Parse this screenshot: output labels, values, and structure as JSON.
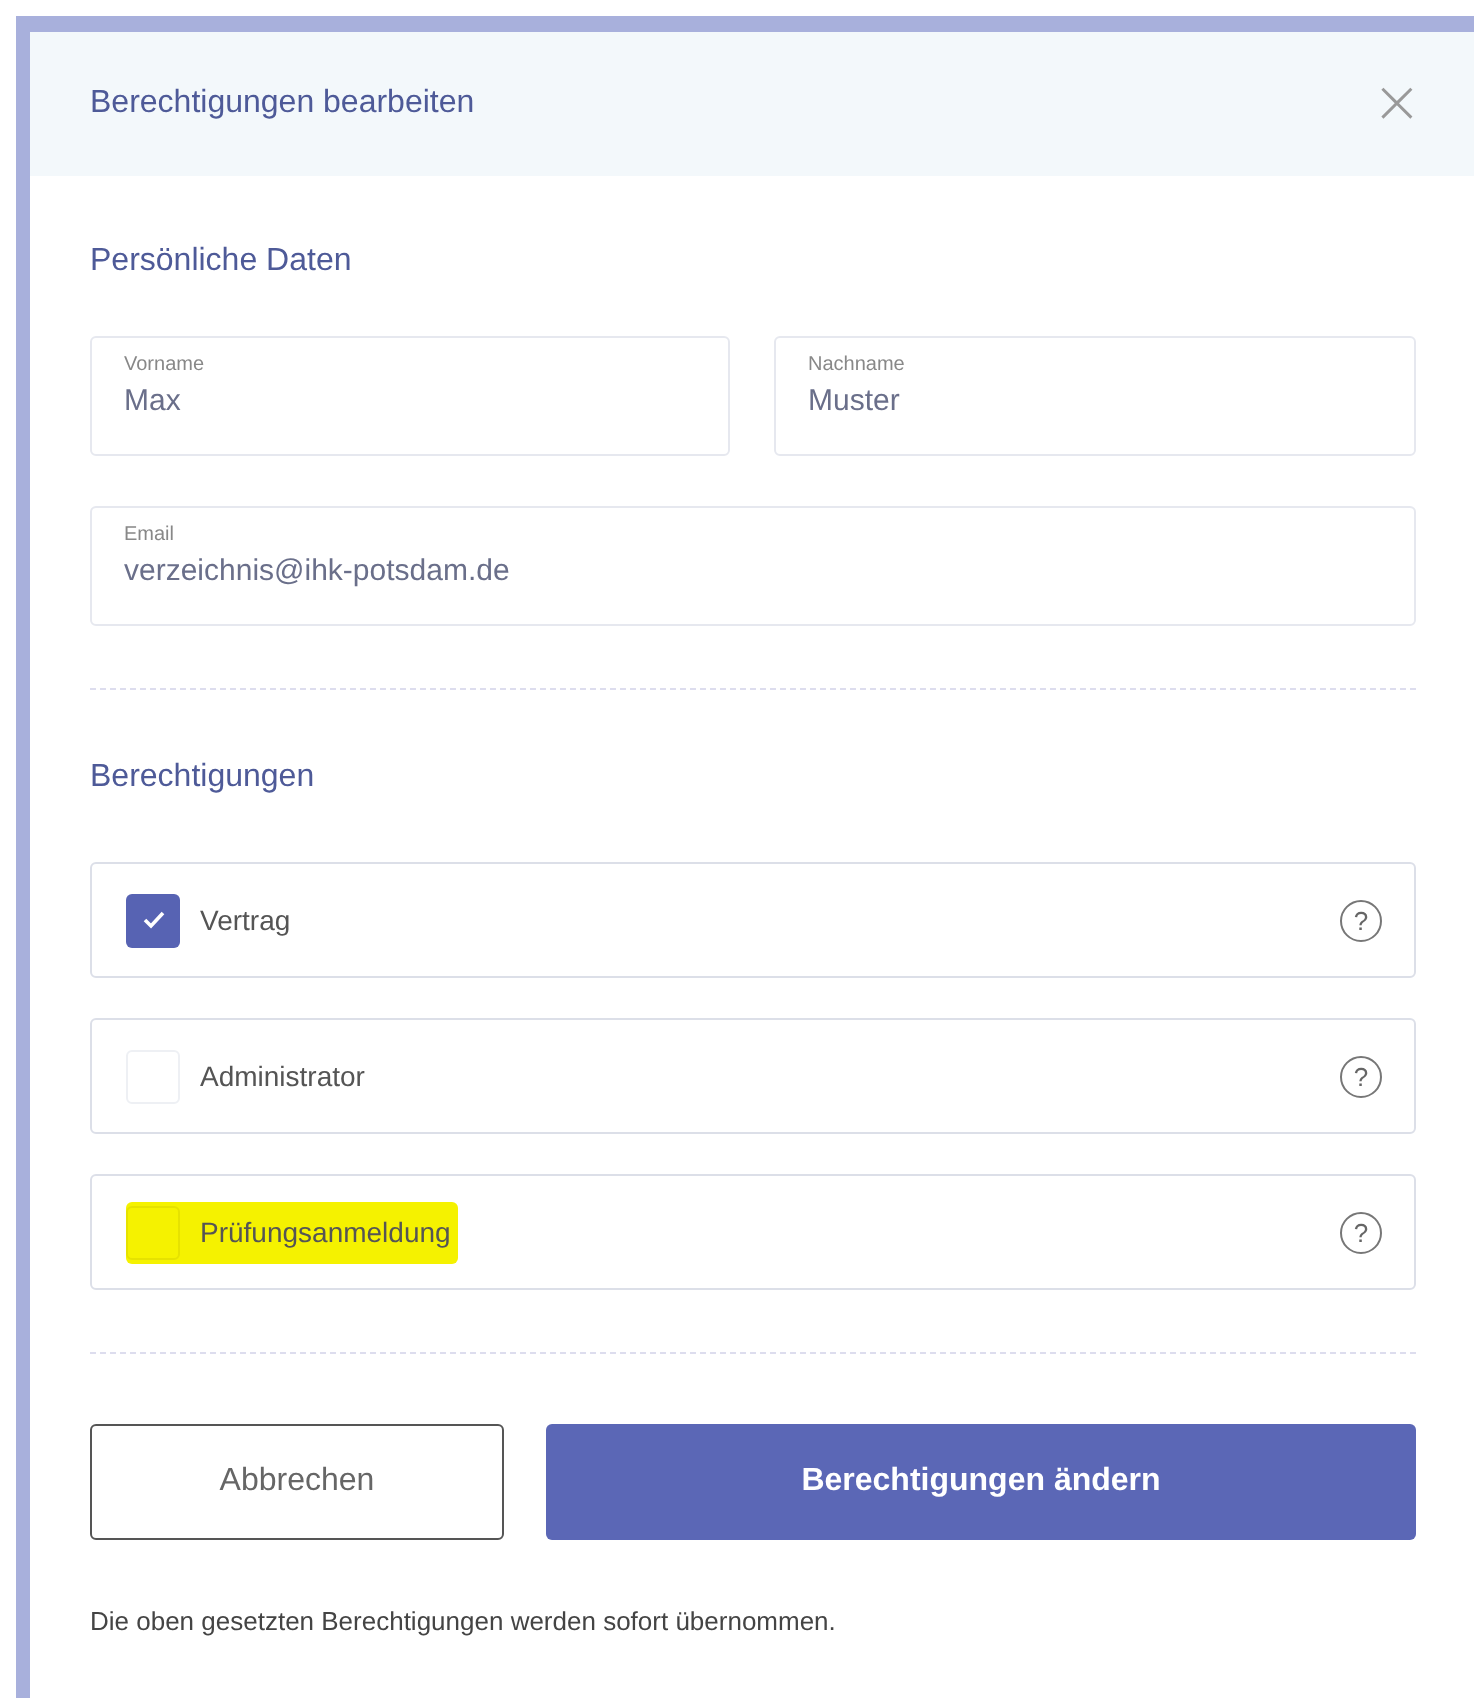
{
  "dialog": {
    "title": "Berechtigungen bearbeiten",
    "close": "×"
  },
  "personal": {
    "heading": "Persönliche Daten",
    "fields": [
      {
        "label": "Vorname",
        "value": "Max"
      },
      {
        "label": "Nachname",
        "value": "Muster"
      },
      {
        "label": "Email",
        "value": "verzeichnis@ihk-potsdam.de"
      }
    ]
  },
  "permissions": {
    "heading": "Berechtigungen",
    "items": [
      {
        "label": "Vertrag",
        "checked": true,
        "highlighted": false,
        "help": "?"
      },
      {
        "label": "Administrator",
        "checked": false,
        "highlighted": false,
        "help": "?"
      },
      {
        "label": "Prüfungsanmeldung",
        "checked": false,
        "highlighted": true,
        "help": "?"
      }
    ]
  },
  "buttons": [
    {
      "label": "Abbrechen",
      "kind": "secondary"
    },
    {
      "label": "Berechtigungen ändern",
      "kind": "primary"
    }
  ],
  "note": "Die oben gesetzten Berechtigungen werden sofort übernommen."
}
